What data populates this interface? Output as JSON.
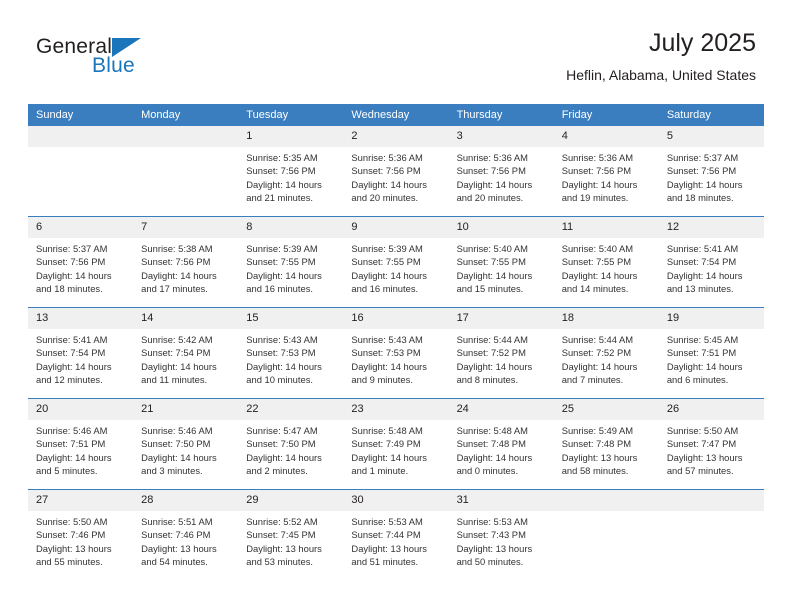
{
  "brand": {
    "name_top": "General",
    "name_bottom": "Blue"
  },
  "header": {
    "title": "July 2025",
    "subtitle": "Heflin, Alabama, United States"
  },
  "calendar": {
    "weekday_headers": [
      "Sunday",
      "Monday",
      "Tuesday",
      "Wednesday",
      "Thursday",
      "Friday",
      "Saturday"
    ],
    "accent_color": "#3a7ebf",
    "daynum_bg": "#f0f0f0",
    "labels": {
      "sunrise": "Sunrise:",
      "sunset": "Sunset:",
      "daylight": "Daylight:"
    },
    "weeks": [
      [
        {
          "day": "",
          "empty": true
        },
        {
          "day": "",
          "empty": true
        },
        {
          "day": "1",
          "sunrise": "Sunrise: 5:35 AM",
          "sunset": "Sunset: 7:56 PM",
          "daylight_line1": "Daylight: 14 hours",
          "daylight_line2": "and 21 minutes."
        },
        {
          "day": "2",
          "sunrise": "Sunrise: 5:36 AM",
          "sunset": "Sunset: 7:56 PM",
          "daylight_line1": "Daylight: 14 hours",
          "daylight_line2": "and 20 minutes."
        },
        {
          "day": "3",
          "sunrise": "Sunrise: 5:36 AM",
          "sunset": "Sunset: 7:56 PM",
          "daylight_line1": "Daylight: 14 hours",
          "daylight_line2": "and 20 minutes."
        },
        {
          "day": "4",
          "sunrise": "Sunrise: 5:36 AM",
          "sunset": "Sunset: 7:56 PM",
          "daylight_line1": "Daylight: 14 hours",
          "daylight_line2": "and 19 minutes."
        },
        {
          "day": "5",
          "sunrise": "Sunrise: 5:37 AM",
          "sunset": "Sunset: 7:56 PM",
          "daylight_line1": "Daylight: 14 hours",
          "daylight_line2": "and 18 minutes."
        }
      ],
      [
        {
          "day": "6",
          "sunrise": "Sunrise: 5:37 AM",
          "sunset": "Sunset: 7:56 PM",
          "daylight_line1": "Daylight: 14 hours",
          "daylight_line2": "and 18 minutes."
        },
        {
          "day": "7",
          "sunrise": "Sunrise: 5:38 AM",
          "sunset": "Sunset: 7:56 PM",
          "daylight_line1": "Daylight: 14 hours",
          "daylight_line2": "and 17 minutes."
        },
        {
          "day": "8",
          "sunrise": "Sunrise: 5:39 AM",
          "sunset": "Sunset: 7:55 PM",
          "daylight_line1": "Daylight: 14 hours",
          "daylight_line2": "and 16 minutes."
        },
        {
          "day": "9",
          "sunrise": "Sunrise: 5:39 AM",
          "sunset": "Sunset: 7:55 PM",
          "daylight_line1": "Daylight: 14 hours",
          "daylight_line2": "and 16 minutes."
        },
        {
          "day": "10",
          "sunrise": "Sunrise: 5:40 AM",
          "sunset": "Sunset: 7:55 PM",
          "daylight_line1": "Daylight: 14 hours",
          "daylight_line2": "and 15 minutes."
        },
        {
          "day": "11",
          "sunrise": "Sunrise: 5:40 AM",
          "sunset": "Sunset: 7:55 PM",
          "daylight_line1": "Daylight: 14 hours",
          "daylight_line2": "and 14 minutes."
        },
        {
          "day": "12",
          "sunrise": "Sunrise: 5:41 AM",
          "sunset": "Sunset: 7:54 PM",
          "daylight_line1": "Daylight: 14 hours",
          "daylight_line2": "and 13 minutes."
        }
      ],
      [
        {
          "day": "13",
          "sunrise": "Sunrise: 5:41 AM",
          "sunset": "Sunset: 7:54 PM",
          "daylight_line1": "Daylight: 14 hours",
          "daylight_line2": "and 12 minutes."
        },
        {
          "day": "14",
          "sunrise": "Sunrise: 5:42 AM",
          "sunset": "Sunset: 7:54 PM",
          "daylight_line1": "Daylight: 14 hours",
          "daylight_line2": "and 11 minutes."
        },
        {
          "day": "15",
          "sunrise": "Sunrise: 5:43 AM",
          "sunset": "Sunset: 7:53 PM",
          "daylight_line1": "Daylight: 14 hours",
          "daylight_line2": "and 10 minutes."
        },
        {
          "day": "16",
          "sunrise": "Sunrise: 5:43 AM",
          "sunset": "Sunset: 7:53 PM",
          "daylight_line1": "Daylight: 14 hours",
          "daylight_line2": "and 9 minutes."
        },
        {
          "day": "17",
          "sunrise": "Sunrise: 5:44 AM",
          "sunset": "Sunset: 7:52 PM",
          "daylight_line1": "Daylight: 14 hours",
          "daylight_line2": "and 8 minutes."
        },
        {
          "day": "18",
          "sunrise": "Sunrise: 5:44 AM",
          "sunset": "Sunset: 7:52 PM",
          "daylight_line1": "Daylight: 14 hours",
          "daylight_line2": "and 7 minutes."
        },
        {
          "day": "19",
          "sunrise": "Sunrise: 5:45 AM",
          "sunset": "Sunset: 7:51 PM",
          "daylight_line1": "Daylight: 14 hours",
          "daylight_line2": "and 6 minutes."
        }
      ],
      [
        {
          "day": "20",
          "sunrise": "Sunrise: 5:46 AM",
          "sunset": "Sunset: 7:51 PM",
          "daylight_line1": "Daylight: 14 hours",
          "daylight_line2": "and 5 minutes."
        },
        {
          "day": "21",
          "sunrise": "Sunrise: 5:46 AM",
          "sunset": "Sunset: 7:50 PM",
          "daylight_line1": "Daylight: 14 hours",
          "daylight_line2": "and 3 minutes."
        },
        {
          "day": "22",
          "sunrise": "Sunrise: 5:47 AM",
          "sunset": "Sunset: 7:50 PM",
          "daylight_line1": "Daylight: 14 hours",
          "daylight_line2": "and 2 minutes."
        },
        {
          "day": "23",
          "sunrise": "Sunrise: 5:48 AM",
          "sunset": "Sunset: 7:49 PM",
          "daylight_line1": "Daylight: 14 hours",
          "daylight_line2": "and 1 minute."
        },
        {
          "day": "24",
          "sunrise": "Sunrise: 5:48 AM",
          "sunset": "Sunset: 7:48 PM",
          "daylight_line1": "Daylight: 14 hours",
          "daylight_line2": "and 0 minutes."
        },
        {
          "day": "25",
          "sunrise": "Sunrise: 5:49 AM",
          "sunset": "Sunset: 7:48 PM",
          "daylight_line1": "Daylight: 13 hours",
          "daylight_line2": "and 58 minutes."
        },
        {
          "day": "26",
          "sunrise": "Sunrise: 5:50 AM",
          "sunset": "Sunset: 7:47 PM",
          "daylight_line1": "Daylight: 13 hours",
          "daylight_line2": "and 57 minutes."
        }
      ],
      [
        {
          "day": "27",
          "sunrise": "Sunrise: 5:50 AM",
          "sunset": "Sunset: 7:46 PM",
          "daylight_line1": "Daylight: 13 hours",
          "daylight_line2": "and 55 minutes."
        },
        {
          "day": "28",
          "sunrise": "Sunrise: 5:51 AM",
          "sunset": "Sunset: 7:46 PM",
          "daylight_line1": "Daylight: 13 hours",
          "daylight_line2": "and 54 minutes."
        },
        {
          "day": "29",
          "sunrise": "Sunrise: 5:52 AM",
          "sunset": "Sunset: 7:45 PM",
          "daylight_line1": "Daylight: 13 hours",
          "daylight_line2": "and 53 minutes."
        },
        {
          "day": "30",
          "sunrise": "Sunrise: 5:53 AM",
          "sunset": "Sunset: 7:44 PM",
          "daylight_line1": "Daylight: 13 hours",
          "daylight_line2": "and 51 minutes."
        },
        {
          "day": "31",
          "sunrise": "Sunrise: 5:53 AM",
          "sunset": "Sunset: 7:43 PM",
          "daylight_line1": "Daylight: 13 hours",
          "daylight_line2": "and 50 minutes."
        },
        {
          "day": "",
          "empty": true
        },
        {
          "day": "",
          "empty": true
        }
      ]
    ]
  }
}
